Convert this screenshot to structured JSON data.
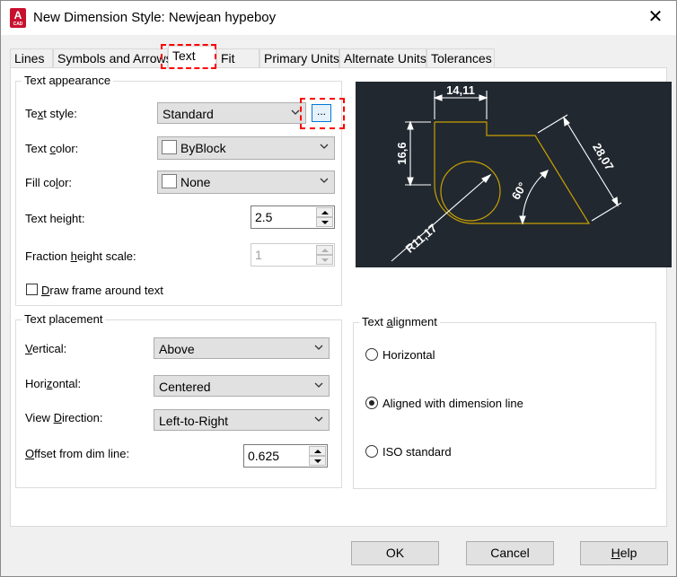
{
  "window": {
    "title": "New Dimension Style: Newjean hypeboy",
    "app_icon_letter": "A",
    "app_icon_sub": "CAD",
    "close_glyph": "✕"
  },
  "tabs": [
    {
      "label": "Lines"
    },
    {
      "label": "Symbols and Arrows"
    },
    {
      "label": "Text",
      "active": true
    },
    {
      "label": "Fit"
    },
    {
      "label": "Primary Units"
    },
    {
      "label": "Alternate Units"
    },
    {
      "label": "Tolerances"
    }
  ],
  "text_appearance": {
    "title": "Text appearance",
    "text_style": {
      "label_pre": "Te",
      "label_ul": "x",
      "label_post": "t style:",
      "value": "Standard",
      "browse": "..."
    },
    "text_color": {
      "label_pre": "Text ",
      "label_ul": "c",
      "label_post": "olor:",
      "value": "ByBlock"
    },
    "fill_color": {
      "label_pre": "Fill co",
      "label_ul": "l",
      "label_post": "or:",
      "value": "None"
    },
    "text_height": {
      "label_pre": "Text hei",
      "label_ul": "g",
      "label_post": "ht:",
      "value": "2.5"
    },
    "fraction_height": {
      "label_pre": "Fraction ",
      "label_ul": "h",
      "label_post": "eight scale:",
      "value": "1"
    },
    "draw_frame": {
      "label_pre": "",
      "label_ul": "D",
      "label_post": "raw frame around text",
      "checked": false
    }
  },
  "text_placement": {
    "title": "Text placement",
    "vertical": {
      "label_pre": "",
      "label_ul": "V",
      "label_post": "ertical:",
      "value": "Above"
    },
    "horizontal": {
      "label_pre": "Hori",
      "label_ul": "z",
      "label_post": "ontal:",
      "value": "Centered"
    },
    "view_direction": {
      "label_pre": "View ",
      "label_ul": "D",
      "label_post": "irection:",
      "value": "Left-to-Right"
    },
    "offset": {
      "label_pre": "",
      "label_ul": "O",
      "label_post": "ffset from dim line:",
      "value": "0.625"
    }
  },
  "text_alignment": {
    "title_pre": "Text ",
    "title_ul": "a",
    "title_post": "lignment",
    "options": [
      {
        "label": "Horizontal",
        "checked": false
      },
      {
        "label": "Aligned with dimension line",
        "checked": true
      },
      {
        "label": "ISO standard",
        "checked": false
      }
    ]
  },
  "preview": {
    "dim_top": "14,11",
    "dim_left": "16,6",
    "dim_diag": "28,07",
    "dim_angle": "60°",
    "dim_radius": "R11,17"
  },
  "buttons": {
    "ok": "OK",
    "cancel": "Cancel",
    "help_ul": "H",
    "help_post": "elp"
  },
  "colors": {
    "preview_bg": "#212830",
    "geometry": "#c8a000",
    "dimension": "#ffffff",
    "highlight": "#ff0000",
    "accent": "#0078d7"
  }
}
